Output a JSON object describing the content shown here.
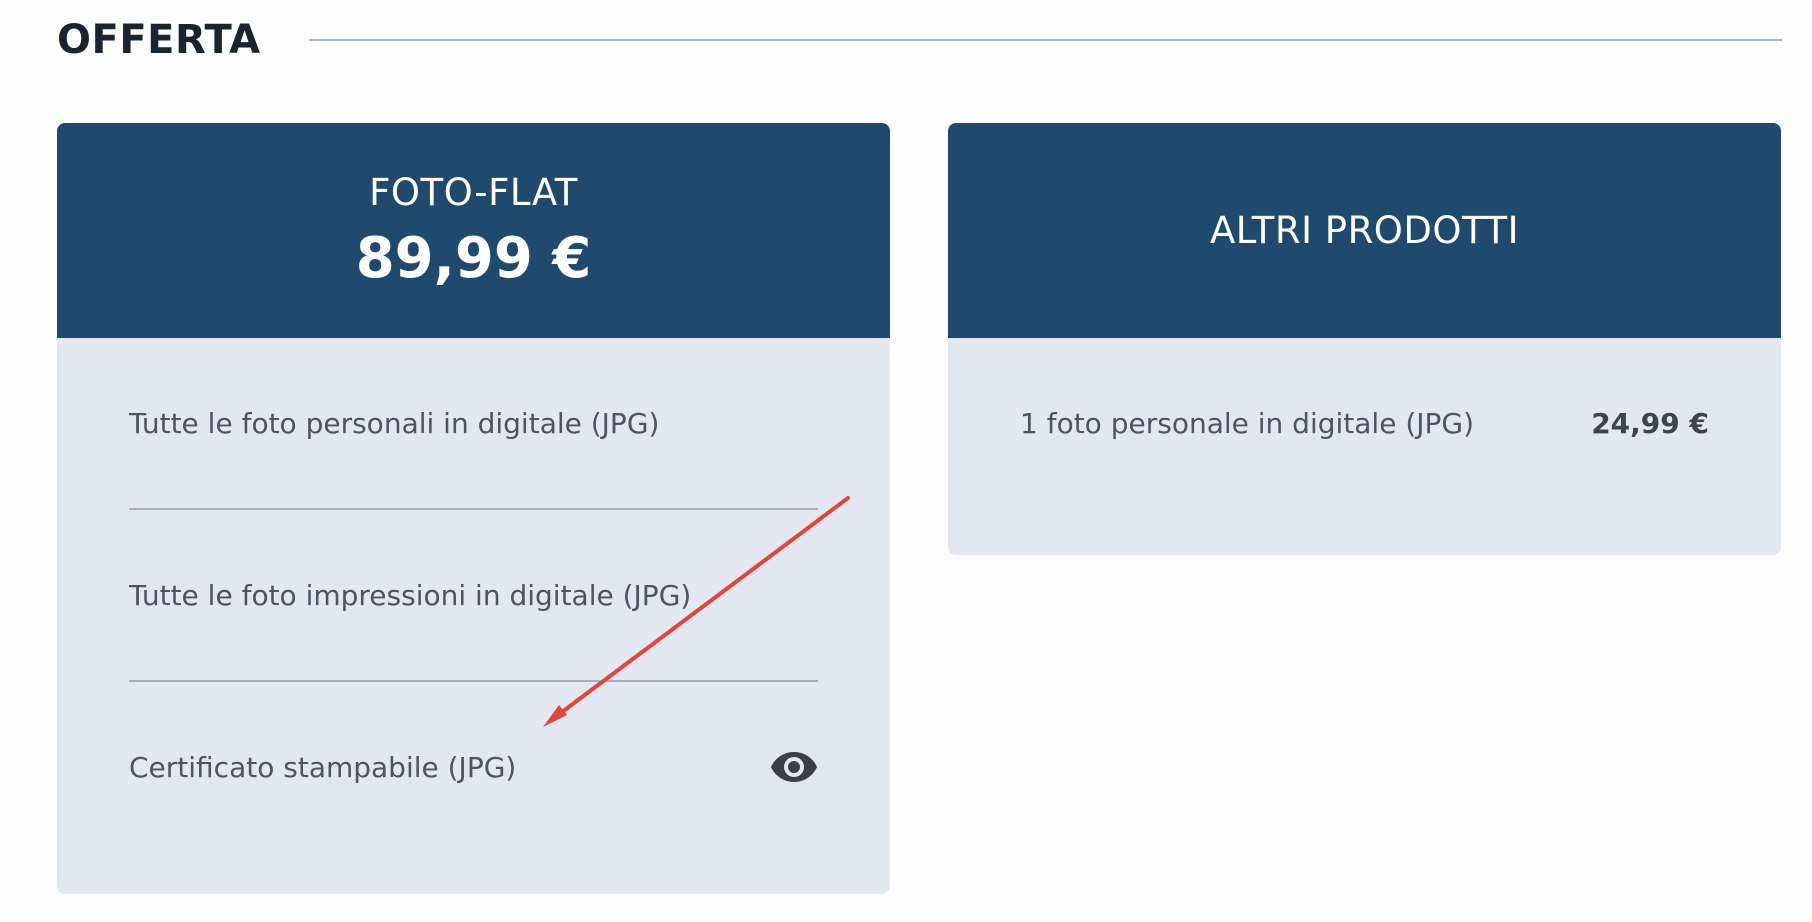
{
  "section": {
    "title": "OFFERTA"
  },
  "cards": [
    {
      "name": "FOTO-FLAT",
      "price": "89,99 €",
      "items": [
        {
          "label": "Tutte le foto personali in digitale (JPG)"
        },
        {
          "label": "Tutte le foto impressioni in digitale (JPG)"
        },
        {
          "label": "Certificato stampabile (JPG)",
          "icon": "eye-icon"
        }
      ]
    },
    {
      "name": "ALTRI PRODOTTI",
      "items": [
        {
          "label": "1 foto personale in digitale (JPG)",
          "price": "24,99 €"
        }
      ]
    }
  ],
  "colors": {
    "card_header": "#1f4a6e",
    "card_body": "#e3e7f0",
    "annotation_arrow": "#e0463a"
  }
}
